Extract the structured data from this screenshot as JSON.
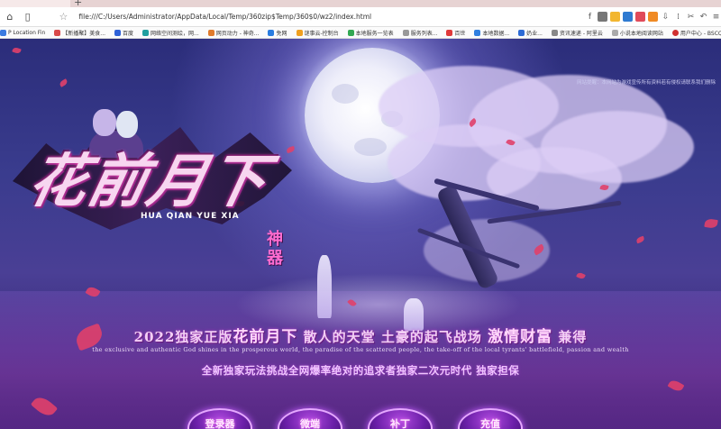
{
  "browser": {
    "new_tab": "+",
    "url": "file:///C:/Users/Administrator/AppData/Local/Temp/360zip$Temp/360$0/wz2/index.html",
    "bookmarks": [
      "P Location Fin",
      "【新播聚】美食...",
      "百度",
      "网络空间测绘，网...",
      "网页动力 - 神奇...",
      "免网",
      "谜事云-控制台",
      "本地服务一览表",
      "服务列表...",
      "百世",
      "本地数据...",
      "奶业...",
      "资讯速递 - 阿里云",
      "小说本地阅读网站",
      "用户中心 - BSCQ"
    ]
  },
  "page": {
    "top_right_note": "网站提醒：本网站为游戏宣传所有资料若有侵权请联系我们删除",
    "logo": {
      "title": "花前月下",
      "pinyin": "HUA QIAN YUE XIA",
      "subtitle": "神器"
    },
    "slogan_line1_a": "2022独家正版",
    "slogan_line1_b": "花前月下",
    "slogan_line1_c": "散人的天堂 土豪的起飞战场",
    "slogan_line1_d": "激情财富",
    "slogan_line1_e": "兼得",
    "slogan_line2": "the exclusive and authentic God shines in the prosperous world, the paradise of the scattered people, the take-off of the local tyrants' battlefield, passion and wealth",
    "slogan_line3": "全新独家玩法挑战全网爆率绝对的追求者独家二次元时代  独家担保",
    "buttons": [
      "登录器",
      "微端",
      "补丁",
      "充值"
    ]
  }
}
